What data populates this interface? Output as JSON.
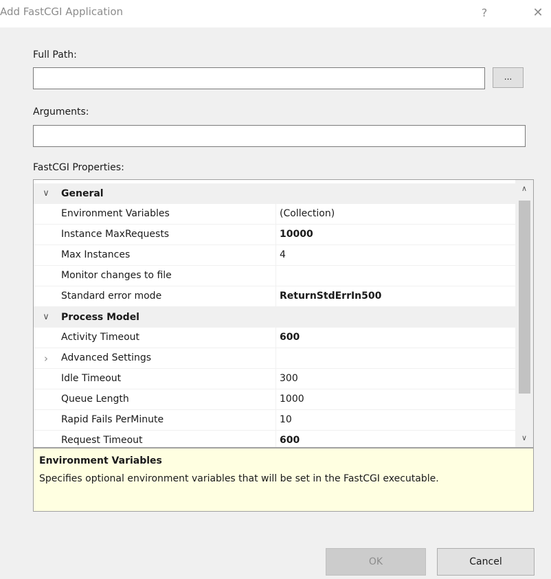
{
  "dialog": {
    "title": "Add FastCGI Application",
    "help_glyph": "?",
    "close_glyph": "✕"
  },
  "form": {
    "full_path_label": "Full Path:",
    "full_path_value": "",
    "browse_label": "...",
    "arguments_label": "Arguments:",
    "arguments_value": "",
    "properties_label": "FastCGI Properties:"
  },
  "grid": {
    "categories": [
      {
        "name": "General",
        "expanded": true,
        "properties": [
          {
            "name": "Environment Variables",
            "value": "(Collection)",
            "bold": false
          },
          {
            "name": "Instance MaxRequests",
            "value": "10000",
            "bold": true
          },
          {
            "name": "Max Instances",
            "value": "4",
            "bold": false
          },
          {
            "name": "Monitor changes to file",
            "value": "",
            "bold": false
          },
          {
            "name": "Standard error mode",
            "value": "ReturnStdErrIn500",
            "bold": true
          }
        ]
      },
      {
        "name": "Process Model",
        "expanded": true,
        "properties": [
          {
            "name": "Activity Timeout",
            "value": "600",
            "bold": true
          },
          {
            "name": "Advanced Settings",
            "value": "",
            "bold": false,
            "expandable": true
          },
          {
            "name": "Idle Timeout",
            "value": "300",
            "bold": false
          },
          {
            "name": "Queue Length",
            "value": "1000",
            "bold": false
          },
          {
            "name": "Rapid Fails PerMinute",
            "value": "10",
            "bold": false
          },
          {
            "name": "Request Timeout",
            "value": "600",
            "bold": true
          }
        ]
      }
    ]
  },
  "description": {
    "title": "Environment Variables",
    "text": "Specifies optional environment variables that will be set in the FastCGI executable."
  },
  "buttons": {
    "ok_label": "OK",
    "ok_enabled": false,
    "cancel_label": "Cancel"
  },
  "icons": {
    "expanded_chevron": "chevron-down-icon",
    "collapsed_chevron": "chevron-right-icon",
    "scroll_up": "scroll-up-icon",
    "scroll_down": "scroll-down-icon"
  },
  "colors": {
    "dialog_bg": "#f0f0f0",
    "titlebar_bg": "#ffffff",
    "category_bg": "#f0f0f0",
    "description_bg": "#ffffe1",
    "disabled_button_bg": "#cccccc"
  }
}
